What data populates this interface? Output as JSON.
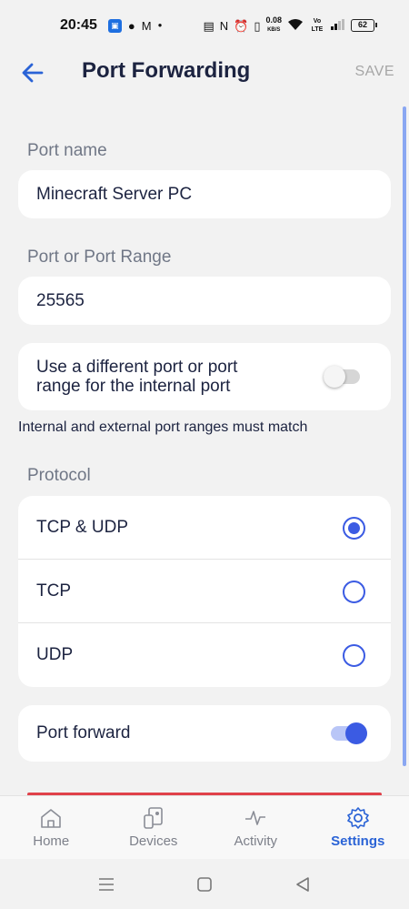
{
  "status_bar": {
    "time": "20:45",
    "net_speed_top": "0.08",
    "net_speed_bottom": "KB/S",
    "volte": "Vo LTE",
    "battery": "62"
  },
  "header": {
    "title": "Port Forwarding",
    "save_label": "SAVE"
  },
  "form": {
    "port_name_label": "Port name",
    "port_name_value": "Minecraft Server PC",
    "port_range_label": "Port or Port Range",
    "port_range_value": "25565",
    "different_port_label": "Use a different port or port range for the internal port",
    "different_port_enabled": false,
    "hint": "Internal and external port ranges must match",
    "protocol_label": "Protocol",
    "protocol_options": [
      {
        "label": "TCP & UDP",
        "selected": true
      },
      {
        "label": "TCP",
        "selected": false
      },
      {
        "label": "UDP",
        "selected": false
      }
    ],
    "port_forward_label": "Port forward",
    "port_forward_enabled": true
  },
  "bottom_nav": {
    "items": [
      {
        "label": "Home",
        "icon": "home-icon"
      },
      {
        "label": "Devices",
        "icon": "devices-icon"
      },
      {
        "label": "Activity",
        "icon": "activity-icon"
      },
      {
        "label": "Settings",
        "icon": "gear-icon"
      }
    ],
    "active": "Settings"
  },
  "colors": {
    "accent": "#3b5be3",
    "title": "#1c2340",
    "danger": "#e0414a"
  }
}
